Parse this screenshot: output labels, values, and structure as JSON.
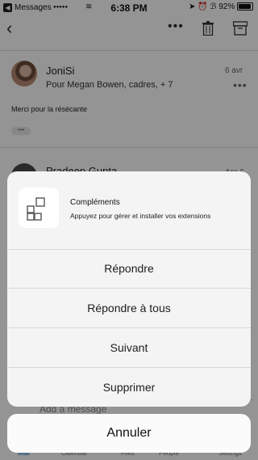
{
  "status_bar": {
    "back_app": "Messages",
    "time": "6:38 PM",
    "battery": "92%",
    "battery_level": 0.92
  },
  "toolbar": {
    "more_label": "•••"
  },
  "thread": {
    "message1": {
      "sender": "JoniSi",
      "recipients": "Pour Megan Bowen, cadres, + 7",
      "date": "6 avr",
      "body": "Merci pour la résécante",
      "more": "•••",
      "expand": "•••"
    },
    "message2": {
      "sender": "Pradeep Gupta",
      "date": "Apr 6"
    },
    "compose_placeholder": "Add a message"
  },
  "tabbar": {
    "items": [
      "Mail",
      "Calendar",
      "Files",
      "People",
      "Settings"
    ]
  },
  "action_sheet": {
    "addin": {
      "icon": "addins-grid-icon",
      "title": "Compléments",
      "subtitle": "Appuyez pour gérer et installer vos extensions"
    },
    "actions": [
      "Répondre",
      "Répondre à tous",
      "Suivant",
      "Supprimer"
    ],
    "cancel": "Annuler"
  },
  "colors": {
    "overlay": "#000000",
    "sheet_bg": "#f4f4f5",
    "tab_accent": "#0078d4"
  }
}
